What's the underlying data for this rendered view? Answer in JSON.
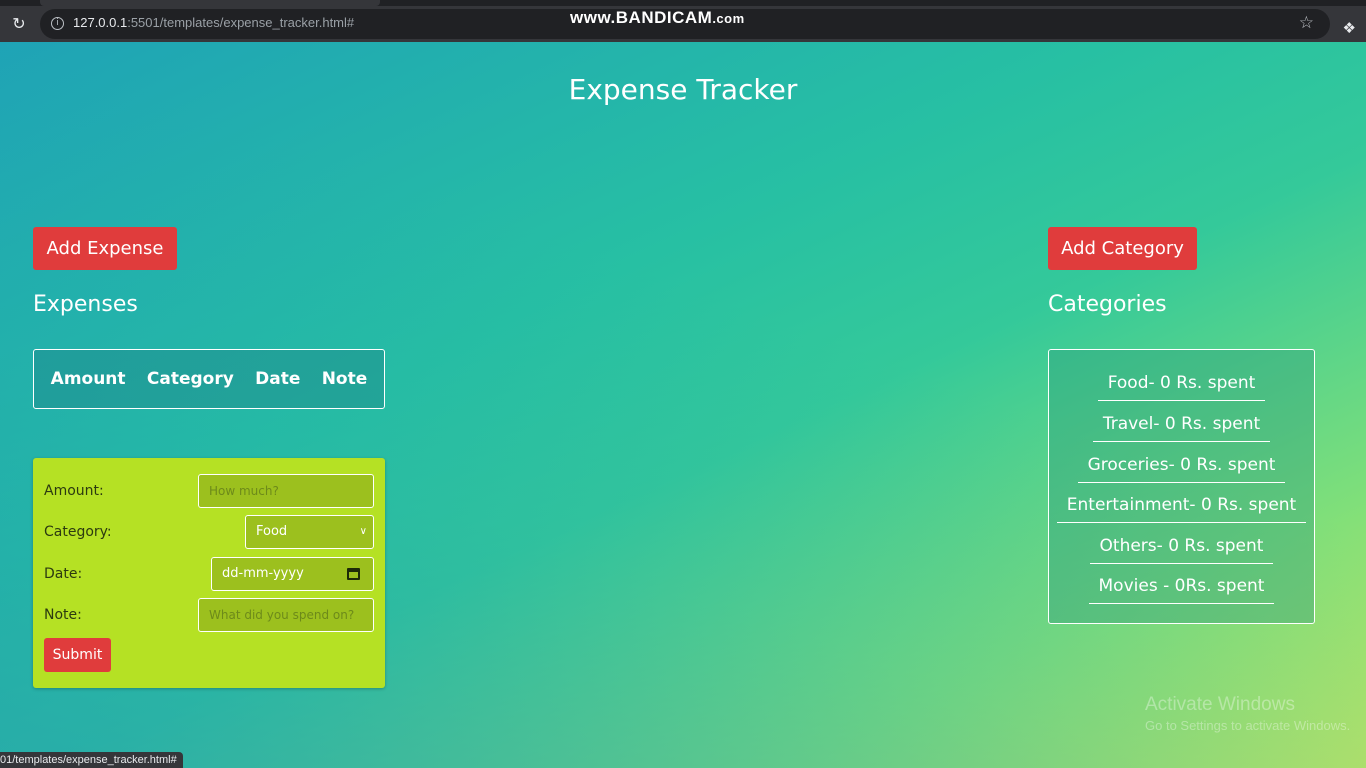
{
  "browser": {
    "url_host": "127.0.0.1",
    "url_path": ":5501/templates/expense_tracker.html#",
    "watermark_main": "www.BANDICAM",
    "watermark_suffix": ".com",
    "status_url": "01/templates/expense_tracker.html#"
  },
  "page": {
    "title": "Expense Tracker",
    "add_expense_label": "Add Expense",
    "add_category_label": "Add Category",
    "expenses_heading": "Expenses",
    "categories_heading": "Categories"
  },
  "expense_table": {
    "headers": [
      "Amount",
      "Category",
      "Date",
      "Note"
    ]
  },
  "expense_form": {
    "amount_label": "Amount:",
    "amount_placeholder": "How much?",
    "category_label": "Category:",
    "category_selected": "Food",
    "date_label": "Date:",
    "date_value": "dd-mm-yyyy",
    "note_label": "Note:",
    "note_placeholder": "What did you spend on?",
    "submit_label": "Submit"
  },
  "categories": [
    "Food- 0 Rs. spent",
    "Travel- 0 Rs. spent",
    "Groceries- 0 Rs. spent",
    "Entertainment- 0 Rs. spent",
    "Others- 0 Rs. spent",
    "Movies - 0Rs. spent"
  ],
  "os_overlay": {
    "line1": "Activate Windows",
    "line2": "Go to Settings to activate Windows."
  },
  "colors": {
    "button_red": "#e03c3c",
    "form_bg": "#b5e124"
  }
}
